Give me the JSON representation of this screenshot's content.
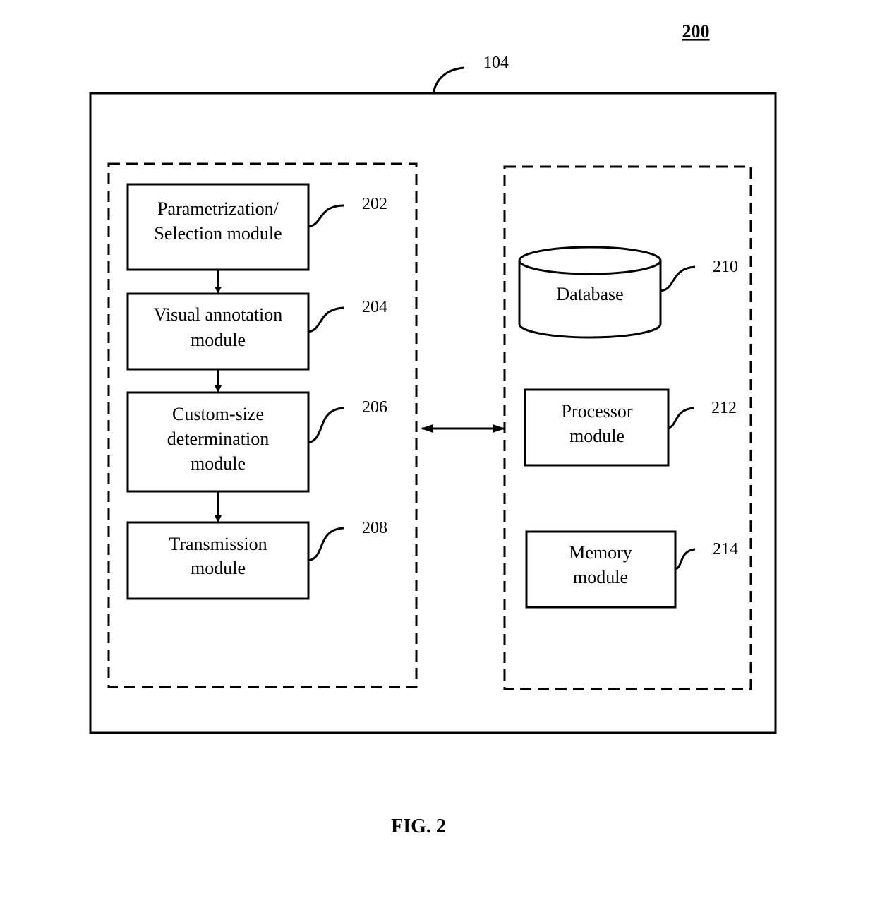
{
  "figure": {
    "number_label": "200",
    "caption": "FIG. 2",
    "outer_ref": "104"
  },
  "left_group": {
    "modules": [
      {
        "ref": "202",
        "lines": [
          "Parametrization/",
          "Selection module"
        ]
      },
      {
        "ref": "204",
        "lines": [
          "Visual annotation",
          "module"
        ]
      },
      {
        "ref": "206",
        "lines": [
          "Custom-size",
          "determination",
          "module"
        ]
      },
      {
        "ref": "208",
        "lines": [
          "Transmission",
          "module"
        ]
      }
    ]
  },
  "right_group": {
    "database": {
      "ref": "210",
      "label": "Database"
    },
    "modules": [
      {
        "ref": "212",
        "lines": [
          "Processor",
          "module"
        ]
      },
      {
        "ref": "214",
        "lines": [
          "Memory",
          "module"
        ]
      }
    ]
  },
  "connections": {
    "left_flow": "sequential-down",
    "between_groups": "bidirectional"
  }
}
